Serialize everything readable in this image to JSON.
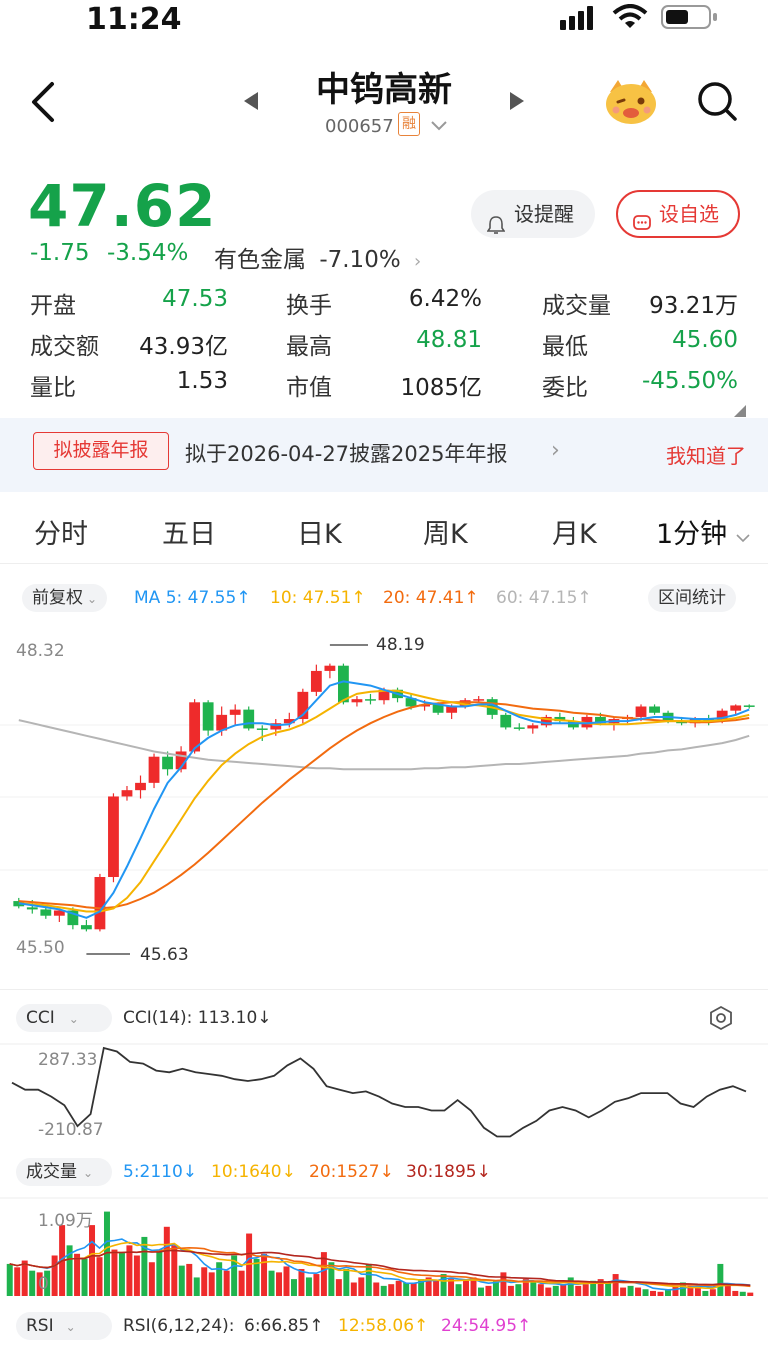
{
  "status_bar": {
    "time": "11:24"
  },
  "header": {
    "title": "中钨高新",
    "code": "000657",
    "margin_badge": "融"
  },
  "quote": {
    "price": "47.62",
    "change": "-1.75",
    "change_pct": "-3.54%",
    "sector_name": "有色金属",
    "sector_pct": "-7.10%",
    "alert_label": "设提醒",
    "watch_label": "设自选",
    "stats": [
      {
        "label": "开盘",
        "value": "47.53",
        "color": "#15a24a"
      },
      {
        "label": "换手",
        "value": "6.42%",
        "color": "#222222"
      },
      {
        "label": "成交量",
        "value": "93.21万",
        "color": "#222222"
      },
      {
        "label": "成交额",
        "value": "43.93亿",
        "color": "#222222"
      },
      {
        "label": "最高",
        "value": "48.81",
        "color": "#15a24a"
      },
      {
        "label": "最低",
        "value": "45.60",
        "color": "#15a24a"
      },
      {
        "label": "量比",
        "value": "1.53",
        "color": "#222222"
      },
      {
        "label": "市值",
        "value": "1085亿",
        "color": "#222222"
      },
      {
        "label": "委比",
        "value": "-45.50%",
        "color": "#15a24a"
      }
    ]
  },
  "banner": {
    "tag": "拟披露年报",
    "text": "拟于2026-04-27披露2025年年报",
    "dismiss": "我知道了"
  },
  "tabs": [
    "分时",
    "五日",
    "日K",
    "周K",
    "月K",
    "1分钟"
  ],
  "kline": {
    "adjust": "前复权",
    "ma5": "MA 5: 47.55↑",
    "ma10": "10: 47.51↑",
    "ma20": "20: 47.41↑",
    "ma60": "60: 47.15↑",
    "range_stats": "区间统计",
    "axis_top": "48.32",
    "axis_bottom": "45.50",
    "high_mark": "48.19",
    "low_mark": "45.63",
    "colors": {
      "up": "#ee2b2b",
      "down": "#1fb34e",
      "ma5": "#2196f3",
      "ma10": "#f5b300",
      "ma20": "#f26b0f",
      "ma60": "#b5b5b5"
    }
  },
  "cci": {
    "selector": "CCI",
    "value": "CCI(14): 113.10↓",
    "axis_top": "287.33",
    "axis_bottom": "-210.87"
  },
  "volume": {
    "selector": "成交量",
    "v5": "5:2110↓",
    "v10": "10:1640↓",
    "v20": "20:1527↓",
    "v30": "30:1895↓",
    "axis_top": "1.09万",
    "axis_bottom": "0"
  },
  "rsi": {
    "selector": "RSI",
    "params": "RSI(6,12,24):",
    "r6": "6:66.85↑",
    "r12": "12:58.06↑",
    "r24": "24:54.95↑"
  },
  "chart_data": {
    "type": "candlestick",
    "ylim": [
      45.5,
      48.32
    ],
    "ohlc": [
      [
        45.92,
        45.95,
        45.85,
        45.87
      ],
      [
        45.86,
        45.93,
        45.8,
        45.84
      ],
      [
        45.84,
        45.88,
        45.75,
        45.78
      ],
      [
        45.78,
        45.85,
        45.72,
        45.83
      ],
      [
        45.83,
        45.86,
        45.65,
        45.69
      ],
      [
        45.69,
        45.74,
        45.63,
        45.65
      ],
      [
        45.65,
        46.18,
        45.63,
        46.15
      ],
      [
        46.15,
        46.95,
        46.1,
        46.92
      ],
      [
        46.92,
        47.02,
        46.88,
        46.98
      ],
      [
        46.98,
        47.12,
        46.9,
        47.05
      ],
      [
        47.05,
        47.33,
        47.0,
        47.3
      ],
      [
        47.3,
        47.35,
        47.12,
        47.18
      ],
      [
        47.18,
        47.4,
        47.15,
        47.35
      ],
      [
        47.35,
        47.85,
        47.33,
        47.82
      ],
      [
        47.82,
        47.84,
        47.5,
        47.55
      ],
      [
        47.55,
        47.78,
        47.5,
        47.7
      ],
      [
        47.7,
        47.8,
        47.6,
        47.75
      ],
      [
        47.75,
        47.78,
        47.55,
        47.57
      ],
      [
        47.57,
        47.6,
        47.45,
        47.56
      ],
      [
        47.56,
        47.66,
        47.5,
        47.62
      ],
      [
        47.62,
        47.72,
        47.58,
        47.66
      ],
      [
        47.66,
        47.95,
        47.62,
        47.92
      ],
      [
        47.92,
        48.18,
        47.88,
        48.12
      ],
      [
        48.12,
        48.19,
        48.05,
        48.17
      ],
      [
        48.17,
        48.19,
        47.8,
        47.82
      ],
      [
        47.82,
        47.88,
        47.78,
        47.85
      ],
      [
        47.85,
        47.9,
        47.8,
        47.84
      ],
      [
        47.84,
        47.96,
        47.8,
        47.94
      ],
      [
        47.94,
        47.96,
        47.82,
        47.86
      ],
      [
        47.86,
        47.9,
        47.75,
        47.78
      ],
      [
        47.78,
        47.84,
        47.74,
        47.8
      ],
      [
        47.8,
        47.82,
        47.7,
        47.72
      ],
      [
        47.72,
        47.8,
        47.66,
        47.78
      ],
      [
        47.78,
        47.86,
        47.76,
        47.84
      ],
      [
        47.84,
        47.88,
        47.82,
        47.85
      ],
      [
        47.85,
        47.87,
        47.66,
        47.7
      ],
      [
        47.7,
        47.72,
        47.56,
        47.58
      ],
      [
        47.58,
        47.62,
        47.55,
        47.57
      ],
      [
        47.57,
        47.62,
        47.52,
        47.6
      ],
      [
        47.6,
        47.7,
        47.58,
        47.68
      ],
      [
        47.68,
        47.72,
        47.62,
        47.64
      ],
      [
        47.64,
        47.68,
        47.56,
        47.58
      ],
      [
        47.58,
        47.7,
        47.56,
        47.68
      ],
      [
        47.68,
        47.72,
        47.6,
        47.62
      ],
      [
        47.62,
        47.68,
        47.55,
        47.66
      ],
      [
        47.66,
        47.7,
        47.62,
        47.68
      ],
      [
        47.68,
        47.8,
        47.64,
        47.78
      ],
      [
        47.78,
        47.8,
        47.7,
        47.72
      ],
      [
        47.72,
        47.74,
        47.62,
        47.64
      ],
      [
        47.64,
        47.68,
        47.6,
        47.62
      ],
      [
        47.62,
        47.68,
        47.58,
        47.66
      ],
      [
        47.66,
        47.7,
        47.6,
        47.64
      ],
      [
        47.64,
        47.76,
        47.62,
        47.74
      ],
      [
        47.74,
        47.8,
        47.7,
        47.79
      ],
      [
        47.79,
        47.8,
        47.76,
        47.78
      ]
    ],
    "ma5": [
      45.9,
      45.88,
      45.86,
      45.84,
      45.8,
      45.76,
      45.82,
      46.0,
      46.25,
      46.52,
      46.8,
      47.05,
      47.2,
      47.38,
      47.48,
      47.55,
      47.6,
      47.62,
      47.62,
      47.6,
      47.61,
      47.7,
      47.84,
      47.98,
      48.02,
      48.0,
      47.98,
      47.94,
      47.9,
      47.86,
      47.82,
      47.8,
      47.78,
      47.78,
      47.8,
      47.8,
      47.74,
      47.68,
      47.64,
      47.62,
      47.62,
      47.62,
      47.62,
      47.63,
      47.64,
      47.64,
      47.66,
      47.68,
      47.68,
      47.67,
      47.66,
      47.66,
      47.67,
      47.7,
      47.75
    ],
    "ma10": [
      45.9,
      45.89,
      45.88,
      45.86,
      45.84,
      45.82,
      45.82,
      45.85,
      45.95,
      46.1,
      46.3,
      46.5,
      46.7,
      46.9,
      47.07,
      47.22,
      47.33,
      47.42,
      47.49,
      47.53,
      47.56,
      47.61,
      47.68,
      47.76,
      47.84,
      47.9,
      47.92,
      47.93,
      47.93,
      47.9,
      47.87,
      47.84,
      47.82,
      47.8,
      47.79,
      47.77,
      47.74,
      47.7,
      47.68,
      47.66,
      47.65,
      47.64,
      47.62,
      47.61,
      47.61,
      47.61,
      47.62,
      47.63,
      47.64,
      47.64,
      47.64,
      47.64,
      47.65,
      47.67,
      47.7
    ],
    "ma20": [
      45.92,
      45.91,
      45.9,
      45.89,
      45.88,
      45.86,
      45.85,
      45.86,
      45.89,
      45.94,
      46.0,
      46.08,
      46.17,
      46.27,
      46.38,
      46.5,
      46.62,
      46.74,
      46.86,
      46.97,
      47.08,
      47.18,
      47.28,
      47.38,
      47.47,
      47.55,
      47.62,
      47.68,
      47.73,
      47.77,
      47.8,
      47.81,
      47.82,
      47.82,
      47.82,
      47.81,
      47.8,
      47.78,
      47.76,
      47.75,
      47.74,
      47.72,
      47.71,
      47.7,
      47.68,
      47.67,
      47.66,
      47.65,
      47.64,
      47.64,
      47.63,
      47.63,
      47.64,
      47.65,
      47.67
    ],
    "ma60": [
      47.65,
      47.62,
      47.59,
      47.56,
      47.53,
      47.5,
      47.47,
      47.44,
      47.41,
      47.38,
      47.35,
      47.33,
      47.31,
      47.29,
      47.27,
      47.26,
      47.25,
      47.24,
      47.23,
      47.22,
      47.21,
      47.2,
      47.19,
      47.19,
      47.18,
      47.18,
      47.18,
      47.18,
      47.18,
      47.18,
      47.19,
      47.19,
      47.2,
      47.2,
      47.21,
      47.22,
      47.23,
      47.23,
      47.24,
      47.25,
      47.26,
      47.27,
      47.28,
      47.29,
      47.3,
      47.31,
      47.33,
      47.34,
      47.36,
      47.37,
      47.39,
      47.41,
      47.43,
      47.46,
      47.5
    ],
    "cci": [
      100,
      60,
      60,
      20,
      -30,
      -150,
      -80,
      300,
      280,
      220,
      210,
      170,
      160,
      180,
      160,
      150,
      140,
      120,
      110,
      120,
      140,
      200,
      240,
      180,
      80,
      60,
      40,
      50,
      20,
      -20,
      -40,
      -40,
      -60,
      -60,
      0,
      -60,
      -160,
      -210,
      -210,
      -160,
      -120,
      -60,
      -40,
      -60,
      -100,
      -60,
      -10,
      10,
      40,
      40,
      40,
      -20,
      -40,
      20,
      60,
      80,
      50
    ],
    "volume": [
      0.38,
      0.34,
      0.42,
      0.3,
      0.28,
      0.3,
      0.48,
      0.84,
      0.6,
      0.5,
      0.44,
      0.84,
      0.46,
      1.0,
      0.55,
      0.52,
      0.6,
      0.48,
      0.7,
      0.4,
      0.55,
      0.82,
      0.6,
      0.36,
      0.38,
      0.22,
      0.34,
      0.28,
      0.4,
      0.3,
      0.48,
      0.3,
      0.74,
      0.44,
      0.5,
      0.3,
      0.28,
      0.35,
      0.2,
      0.32,
      0.22,
      0.26,
      0.52,
      0.4,
      0.2,
      0.32,
      0.16,
      0.22,
      0.38,
      0.16,
      0.12,
      0.14,
      0.18,
      0.16,
      0.15,
      0.2,
      0.22,
      0.18,
      0.26,
      0.2,
      0.14,
      0.18,
      0.22,
      0.1,
      0.12,
      0.18,
      0.28,
      0.12,
      0.14,
      0.2,
      0.16,
      0.14,
      0.1,
      0.12,
      0.14,
      0.22,
      0.12,
      0.14,
      0.18,
      0.2,
      0.16,
      0.26,
      0.1,
      0.12,
      0.1,
      0.08,
      0.06,
      0.05,
      0.08,
      0.12,
      0.16,
      0.12,
      0.1,
      0.06,
      0.08,
      0.38,
      0.12,
      0.06,
      0.05,
      0.04
    ]
  }
}
